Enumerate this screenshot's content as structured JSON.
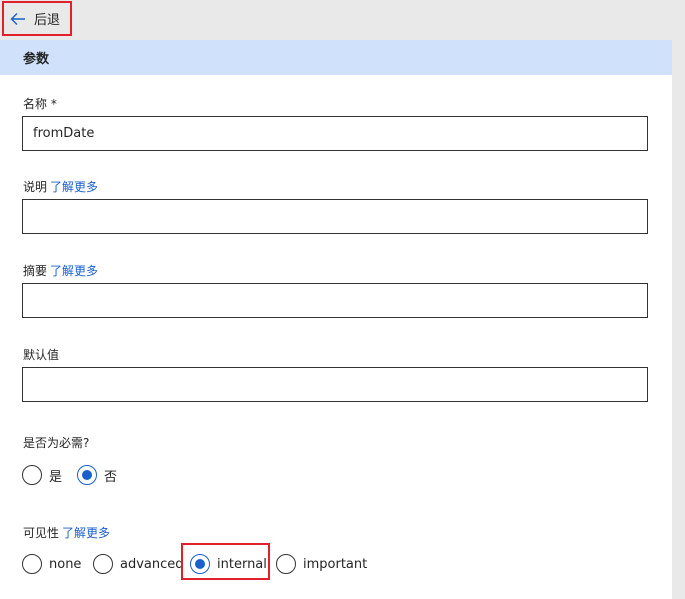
{
  "back": {
    "label": "后退"
  },
  "section": {
    "title": "参数"
  },
  "fields": {
    "name": {
      "label": "名称 *",
      "value": "fromDate"
    },
    "description": {
      "label": "说明",
      "link": "了解更多",
      "value": ""
    },
    "summary": {
      "label": "摘要",
      "link": "了解更多",
      "value": ""
    },
    "default": {
      "label": "默认值",
      "value": ""
    }
  },
  "required": {
    "label": "是否为必需?",
    "options": [
      "是",
      "否"
    ],
    "selected": "否"
  },
  "visibility": {
    "label": "可见性",
    "link": "了解更多",
    "options": [
      "none",
      "advanced",
      "internal",
      "important"
    ],
    "selected": "internal"
  },
  "colors": {
    "accent": "#1a5fcc",
    "header_bg": "#cfe1fb",
    "highlight": "#e0202a"
  }
}
